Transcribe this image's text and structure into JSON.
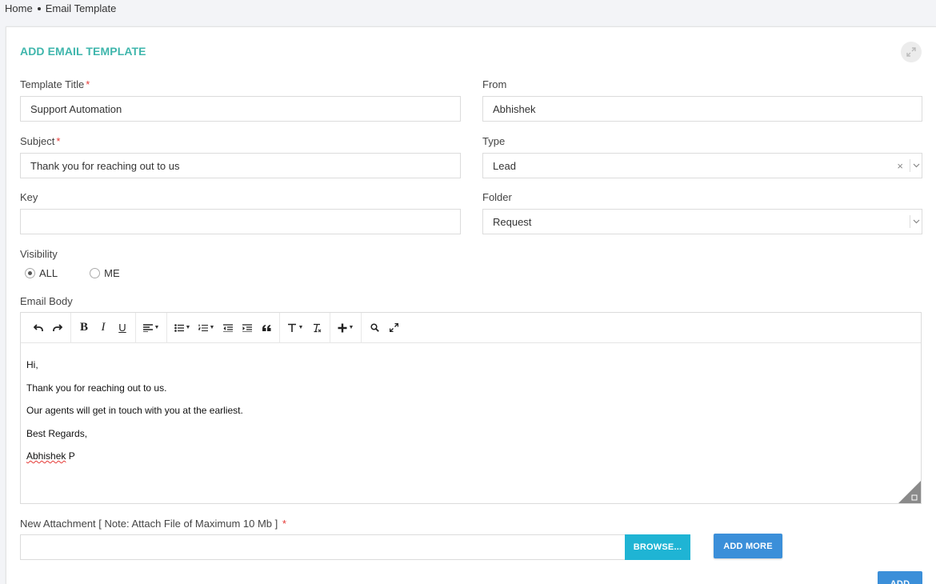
{
  "breadcrumb": {
    "home": "Home",
    "current": "Email Template"
  },
  "card": {
    "title": "ADD EMAIL TEMPLATE"
  },
  "form": {
    "template_title": {
      "label": "Template Title",
      "required": "*",
      "value": "Support Automation"
    },
    "from": {
      "label": "From",
      "value": "Abhishek"
    },
    "subject": {
      "label": "Subject",
      "required": "*",
      "value": "Thank you for reaching out to us"
    },
    "type": {
      "label": "Type",
      "value": "Lead",
      "clear": "×"
    },
    "key": {
      "label": "Key",
      "value": ""
    },
    "folder": {
      "label": "Folder",
      "value": "Request"
    },
    "visibility": {
      "label": "Visibility",
      "options": [
        {
          "label": "ALL",
          "checked": true
        },
        {
          "label": "ME",
          "checked": false
        }
      ]
    },
    "email_body": {
      "label": "Email Body",
      "lines": [
        "Hi,",
        "Thank you for reaching out to us.",
        "Our agents will get in touch with you at the earliest.",
        "Best Regards,"
      ],
      "signature_first": "Abhishek",
      "signature_last": " P"
    },
    "attachment": {
      "label": "New Attachment [ Note: Attach File of Maximum 10 Mb ]",
      "required": "*"
    }
  },
  "toolbar_icons": [
    "undo-icon",
    "redo-icon",
    "bold-icon",
    "italic-icon",
    "underline-icon",
    "align-icon",
    "bullet-list-icon",
    "numbered-list-icon",
    "outdent-icon",
    "indent-icon",
    "quote-icon",
    "font-size-icon",
    "clear-format-icon",
    "insert-icon",
    "search-icon",
    "fullscreen-icon"
  ],
  "buttons": {
    "browse": "BROWSE...",
    "add_more": "ADD MORE",
    "add": "ADD"
  },
  "colors": {
    "accent": "#3fb6ac",
    "primary": "#3b8fd9",
    "browse": "#1fb4d4",
    "required": "#e53935"
  }
}
